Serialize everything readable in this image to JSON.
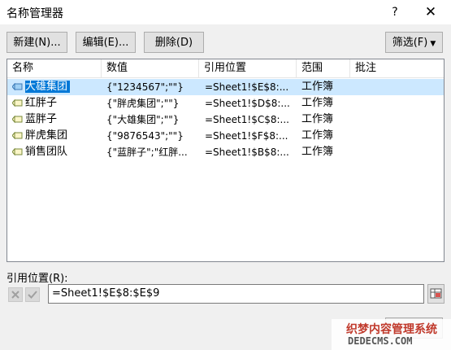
{
  "window": {
    "title": "名称管理器",
    "help_label": "?",
    "close_label": "✕"
  },
  "toolbar": {
    "new_label": "新建(N)...",
    "edit_label": "编辑(E)...",
    "delete_label": "删除(D)",
    "filter_label": "筛选(F)"
  },
  "table": {
    "columns": [
      "名称",
      "数值",
      "引用位置",
      "范围",
      "批注"
    ],
    "rows": [
      {
        "name": "大雄集团",
        "value": "{\"1234567\";\"\"}",
        "ref": "=Sheet1!$E$8:...",
        "scope": "工作簿",
        "comment": "",
        "selected": true
      },
      {
        "name": "红胖子",
        "value": "{\"胖虎集团\";\"\"}",
        "ref": "=Sheet1!$D$8:...",
        "scope": "工作簿",
        "comment": "",
        "selected": false
      },
      {
        "name": "蓝胖子",
        "value": "{\"大雄集团\";\"\"}",
        "ref": "=Sheet1!$C$8:...",
        "scope": "工作簿",
        "comment": "",
        "selected": false
      },
      {
        "name": "胖虎集团",
        "value": "{\"9876543\";\"\"}",
        "ref": "=Sheet1!$F$8:...",
        "scope": "工作簿",
        "comment": "",
        "selected": false
      },
      {
        "name": "销售团队",
        "value": "{\"蓝胖子\";\"红胖...",
        "ref": "=Sheet1!$B$8:...",
        "scope": "工作簿",
        "comment": "",
        "selected": false
      }
    ]
  },
  "reference": {
    "label": "引用位置(R):",
    "value": "=Sheet1!$E$8:$E$9"
  },
  "watermark": {
    "line1": "织梦内容管理系统",
    "line2": "DEDECMS.COM"
  },
  "colors": {
    "selection_bg": "#cce8ff",
    "selection_name_bg": "#0078d7",
    "dialog_bg": "#f0f0f0"
  }
}
